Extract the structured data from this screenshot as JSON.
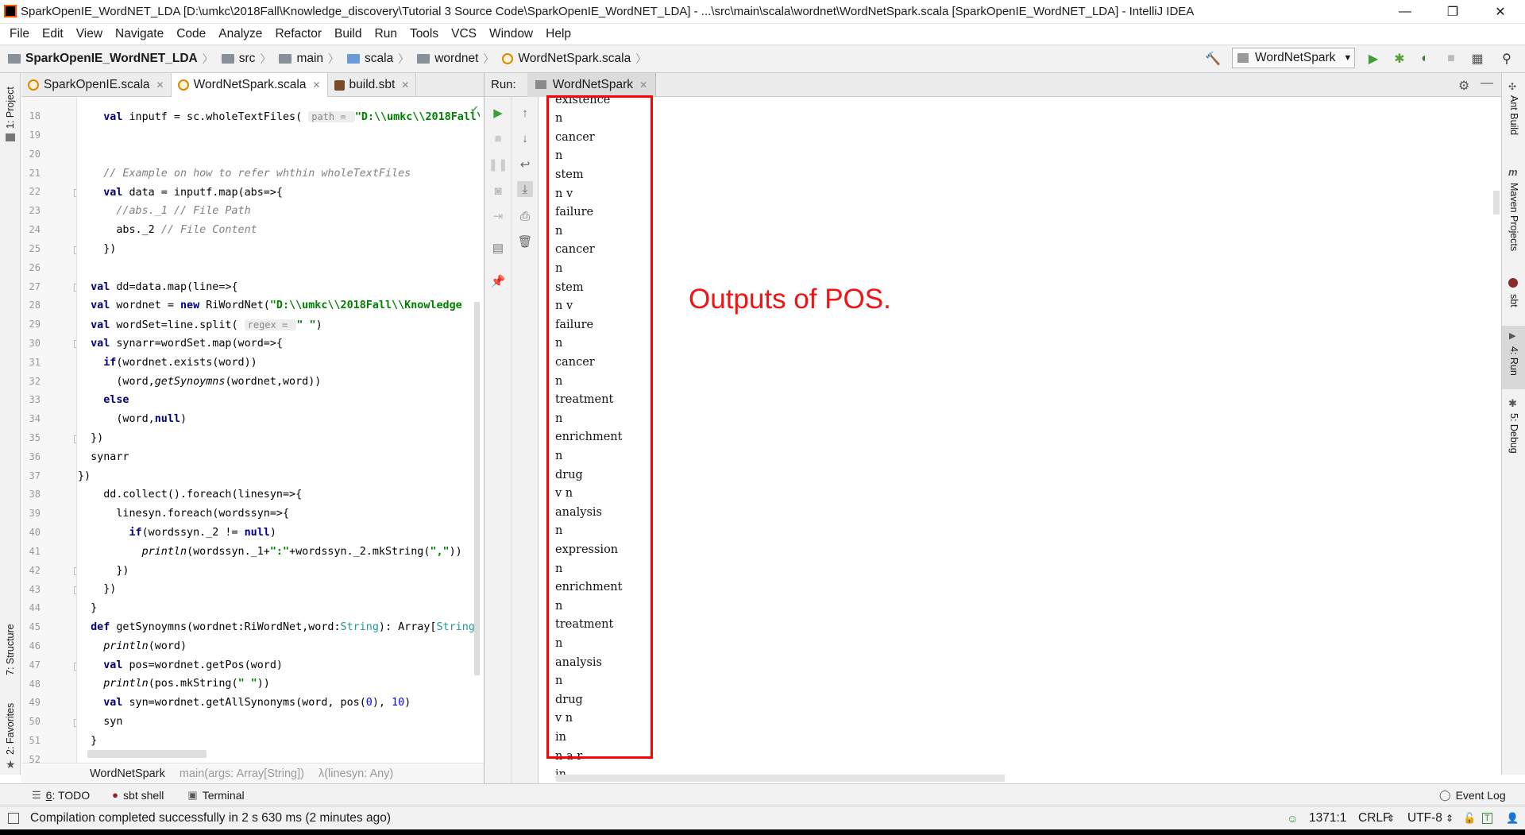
{
  "window": {
    "title": "SparkOpenIE_WordNET_LDA [D:\\umkc\\2018Fall\\Knowledge_discovery\\Tutorial 3 Source Code\\SparkOpenIE_WordNET_LDA] - ...\\src\\main\\scala\\wordnet\\WordNetSpark.scala [SparkOpenIE_WordNET_LDA] - IntelliJ IDEA",
    "minimize": "—",
    "restore": "❐",
    "close": "✕"
  },
  "menu": [
    "File",
    "Edit",
    "View",
    "Navigate",
    "Code",
    "Analyze",
    "Refactor",
    "Build",
    "Run",
    "Tools",
    "VCS",
    "Window",
    "Help"
  ],
  "breadcrumbs": {
    "project": "SparkOpenIE_WordNET_LDA",
    "src": "src",
    "main": "main",
    "scala": "scala",
    "pkg": "wordnet",
    "file": "WordNetSpark.scala"
  },
  "run_config": "WordNetSpark",
  "left_tool_tabs": {
    "project": "1: Project",
    "structure": "7: Structure",
    "favorites": "2: Favorites"
  },
  "right_tool_tabs": {
    "ant": "Ant Build",
    "maven": "Maven Projects",
    "sbt": "sbt",
    "run": "4: Run",
    "debug": "5: Debug"
  },
  "editor_tabs": [
    {
      "label": "SparkOpenIE.scala"
    },
    {
      "label": "WordNetSpark.scala"
    },
    {
      "label": "build.sbt"
    }
  ],
  "line_numbers": [
    "18",
    "19",
    "20",
    "21",
    "22",
    "23",
    "24",
    "25",
    "26",
    "27",
    "28",
    "29",
    "30",
    "31",
    "32",
    "33",
    "34",
    "35",
    "36",
    "37",
    "38",
    "39",
    "40",
    "41",
    "42",
    "43",
    "44",
    "45",
    "46",
    "47",
    "48",
    "49",
    "50",
    "51",
    "52"
  ],
  "code": {
    "l18a": "    ",
    "l18b": "val",
    "l18c": " inputf = sc.wholeTextFiles( ",
    "l18hint": "path = ",
    "l18str": "\"D:\\\\umkc\\\\2018Fall\\\\",
    "l21": "    // Example on how to refer whthin wholeTextFiles",
    "l22a": "    ",
    "l22b": "val",
    "l22c": " data = inputf.map(abs=>{",
    "l23": "      //abs._1 // File Path",
    "l24a": "      abs._2 ",
    "l24b": "// File Content",
    "l25": "    })",
    "l27a": "  ",
    "l27b": "val",
    "l27c": " dd=data.map(line=>{",
    "l28a": "  ",
    "l28b": "val",
    "l28c": " wordnet = ",
    "l28d": "new",
    "l28e": " RiWordNet(",
    "l28f": "\"D:\\\\umkc\\\\2018Fall\\\\Knowledge",
    "l29a": "  ",
    "l29b": "val",
    "l29c": " wordSet=line.split( ",
    "l29hint": "regex = ",
    "l29str": "\" \"",
    "l29d": ")",
    "l30a": "  ",
    "l30b": "val",
    "l30c": " synarr=wordSet.map(word=>{",
    "l31a": "    ",
    "l31b": "if",
    "l31c": "(wordnet.exists(word))",
    "l32a": "      (word,",
    "l32b": "getSynoymns",
    "l32c": "(wordnet,word))",
    "l33a": "    ",
    "l33b": "else",
    "l34a": "      (word,",
    "l34b": "null",
    "l34c": ")",
    "l35": "  })",
    "l36": "  synarr",
    "l37": "})",
    "l38": "    dd.collect().foreach(linesyn=>{",
    "l39": "      linesyn.foreach(wordssyn=>{",
    "l40a": "        ",
    "l40b": "if",
    "l40c": "(wordssyn._2 != ",
    "l40d": "null",
    "l40e": ")",
    "l41a": "          ",
    "l41b": "println",
    "l41c": "(wordssyn._1+",
    "l41d": "\":\"",
    "l41e": "+wordssyn._2.mkString(",
    "l41f": "\",\"",
    "l41g": "))",
    "l42": "      })",
    "l43": "    })",
    "l44": "  }",
    "l45a": "  ",
    "l45b": "def",
    "l45c": " getSynoymns(wordnet:RiWordNet,word:",
    "l45d": "String",
    "l45e": "): Array[",
    "l45f": "String",
    "l46a": "    ",
    "l46b": "println",
    "l46c": "(word)",
    "l47a": "    ",
    "l47b": "val",
    "l47c": " pos=wordnet.getPos(word)",
    "l48a": "    ",
    "l48b": "println",
    "l48c": "(pos.mkString(",
    "l48d": "\" \"",
    "l48e": "))",
    "l49a": "    ",
    "l49b": "val",
    "l49c": " syn=wordnet.getAllSynonyms(word, pos(",
    "l49d": "0",
    "l49e": "), ",
    "l49f": "10",
    "l49g": ")",
    "l50": "    syn",
    "l51": "  }"
  },
  "editor_breadcrumb": [
    "WordNetSpark",
    "main(args: Array[String])",
    "λ(linesyn: Any)"
  ],
  "run_panel": {
    "label": "Run:",
    "tab": "WordNetSpark"
  },
  "console_output": [
    "existence",
    "n",
    "cancer",
    "n",
    "stem",
    "n v",
    "failure",
    "n",
    "cancer",
    "n",
    "stem",
    "n v",
    "failure",
    "n",
    "cancer",
    "n",
    "treatment",
    "n",
    "enrichment",
    "n",
    "drug",
    "v n",
    "analysis",
    "n",
    "expression",
    "n",
    "enrichment",
    "n",
    "treatment",
    "n",
    "analysis",
    "n",
    "drug",
    "v n",
    "in",
    "n a r",
    "in"
  ],
  "annotation": "Outputs of POS.",
  "bottom_tabs": {
    "todo_num": "6",
    "todo": ": TODO",
    "sbt": "sbt shell",
    "terminal": "Terminal",
    "event_log": "Event Log"
  },
  "status": {
    "message": "Compilation completed successfully in 2 s 630 ms (2 minutes ago)",
    "position": "1371:1",
    "line_sep": "CRLF",
    "encoding": "UTF-8",
    "sep_arrows": "⇕",
    "enc_arrows": "⇕"
  },
  "colors": {
    "annotation_red": "#f01414",
    "keyword": "#000080",
    "string": "#008000"
  }
}
